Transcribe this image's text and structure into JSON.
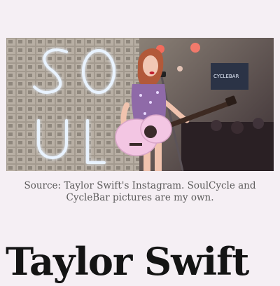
{
  "hero": {
    "image_subject": "Taylor Swift performing on stage with a pink acoustic guitar in front of a SoulCycle neon sign",
    "neon_sign_text": "SOUL",
    "studio_sign_text": "CYCLEBAR"
  },
  "caption": "Source: Taylor Swift's Instagram. SoulCycle and CycleBar pictures are my own.",
  "article": {
    "title": "Taylor Swift"
  },
  "colors": {
    "page_background": "#f5eff4",
    "caption_text": "#5c5b5b",
    "title_text": "#141414",
    "neon": "#e9f3ff",
    "guitar": "#f3c6e3"
  }
}
